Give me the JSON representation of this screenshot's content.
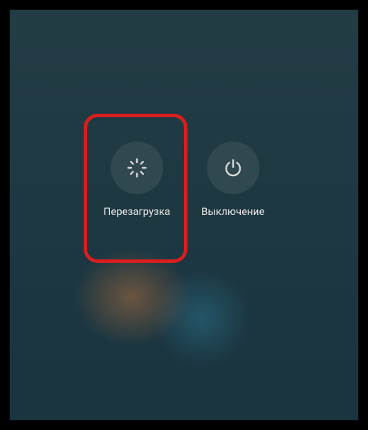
{
  "power_menu": {
    "reboot": {
      "label": "Перезагрузка",
      "icon": "spinner-icon"
    },
    "shutdown": {
      "label": "Выключение",
      "icon": "power-icon"
    }
  }
}
